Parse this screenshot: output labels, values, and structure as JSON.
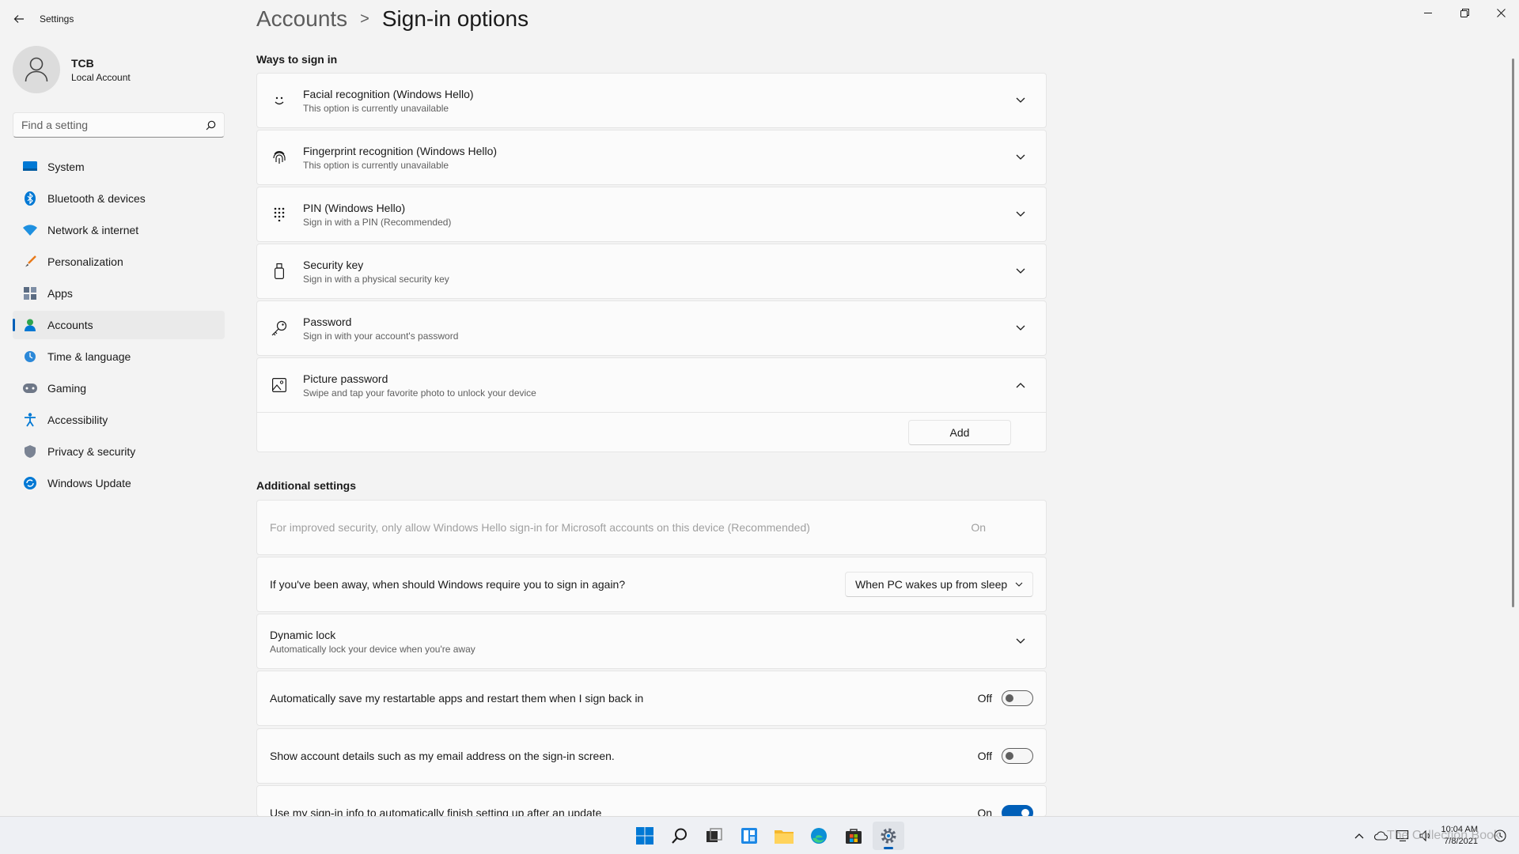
{
  "app": {
    "title": "Settings"
  },
  "profile": {
    "name": "TCB",
    "account_type": "Local Account"
  },
  "search": {
    "placeholder": "Find a setting",
    "icon": "search-icon"
  },
  "nav": {
    "items": [
      {
        "label": "System",
        "icon": "system-icon"
      },
      {
        "label": "Bluetooth & devices",
        "icon": "bluetooth-icon"
      },
      {
        "label": "Network & internet",
        "icon": "wifi-icon"
      },
      {
        "label": "Personalization",
        "icon": "brush-icon"
      },
      {
        "label": "Apps",
        "icon": "apps-icon"
      },
      {
        "label": "Accounts",
        "icon": "person-icon",
        "active": true
      },
      {
        "label": "Time & language",
        "icon": "globe-clock-icon"
      },
      {
        "label": "Gaming",
        "icon": "gamepad-icon"
      },
      {
        "label": "Accessibility",
        "icon": "accessibility-icon"
      },
      {
        "label": "Privacy & security",
        "icon": "shield-icon"
      },
      {
        "label": "Windows Update",
        "icon": "update-icon"
      }
    ]
  },
  "breadcrumb": {
    "parent": "Accounts",
    "separator": ">",
    "current": "Sign-in options"
  },
  "ways_to_sign_in": {
    "title": "Ways to sign in",
    "options": [
      {
        "title": "Facial recognition (Windows Hello)",
        "subtitle": "This option is currently unavailable",
        "icon": "face-icon"
      },
      {
        "title": "Fingerprint recognition (Windows Hello)",
        "subtitle": "This option is currently unavailable",
        "icon": "fingerprint-icon"
      },
      {
        "title": "PIN (Windows Hello)",
        "subtitle": "Sign in with a PIN (Recommended)",
        "icon": "pin-keypad-icon"
      },
      {
        "title": "Security key",
        "subtitle": "Sign in with a physical security key",
        "icon": "usb-key-icon"
      },
      {
        "title": "Password",
        "subtitle": "Sign in with your account's password",
        "icon": "key-icon"
      }
    ],
    "picture_password": {
      "title": "Picture password",
      "subtitle": "Swipe and tap your favorite photo to unlock your device",
      "icon": "picture-icon",
      "button": "Add"
    }
  },
  "additional_settings": {
    "title": "Additional settings",
    "hello_only": {
      "text": "For improved security, only allow Windows Hello sign-in for Microsoft accounts on this device (Recommended)",
      "state": "On"
    },
    "require_signin": {
      "text": "If you've been away, when should Windows require you to sign in again?",
      "value": "When PC wakes up from sleep"
    },
    "dynamic_lock": {
      "title": "Dynamic lock",
      "subtitle": "Automatically lock your device when you're away"
    },
    "restart_apps": {
      "text": "Automatically save my restartable apps and restart them when I sign back in",
      "state": "Off"
    },
    "account_details": {
      "text": "Show account details such as my email address on the sign-in screen.",
      "state": "Off"
    },
    "use_signin_info": {
      "text": "Use my sign-in info to automatically finish setting up after an update",
      "state": "On"
    }
  },
  "taskbar": {
    "apps": [
      "windows-start-icon",
      "search-icon",
      "task-view-icon",
      "widgets-icon",
      "file-explorer-icon",
      "edge-icon",
      "store-icon",
      "settings-icon"
    ],
    "clock": {
      "time": "10:04 AM",
      "date": "7/8/2021"
    },
    "watermark": "The Collection Book"
  },
  "colors": {
    "accent": "#005fb8",
    "background": "#f3f3f3",
    "card": "#fbfbfb"
  }
}
